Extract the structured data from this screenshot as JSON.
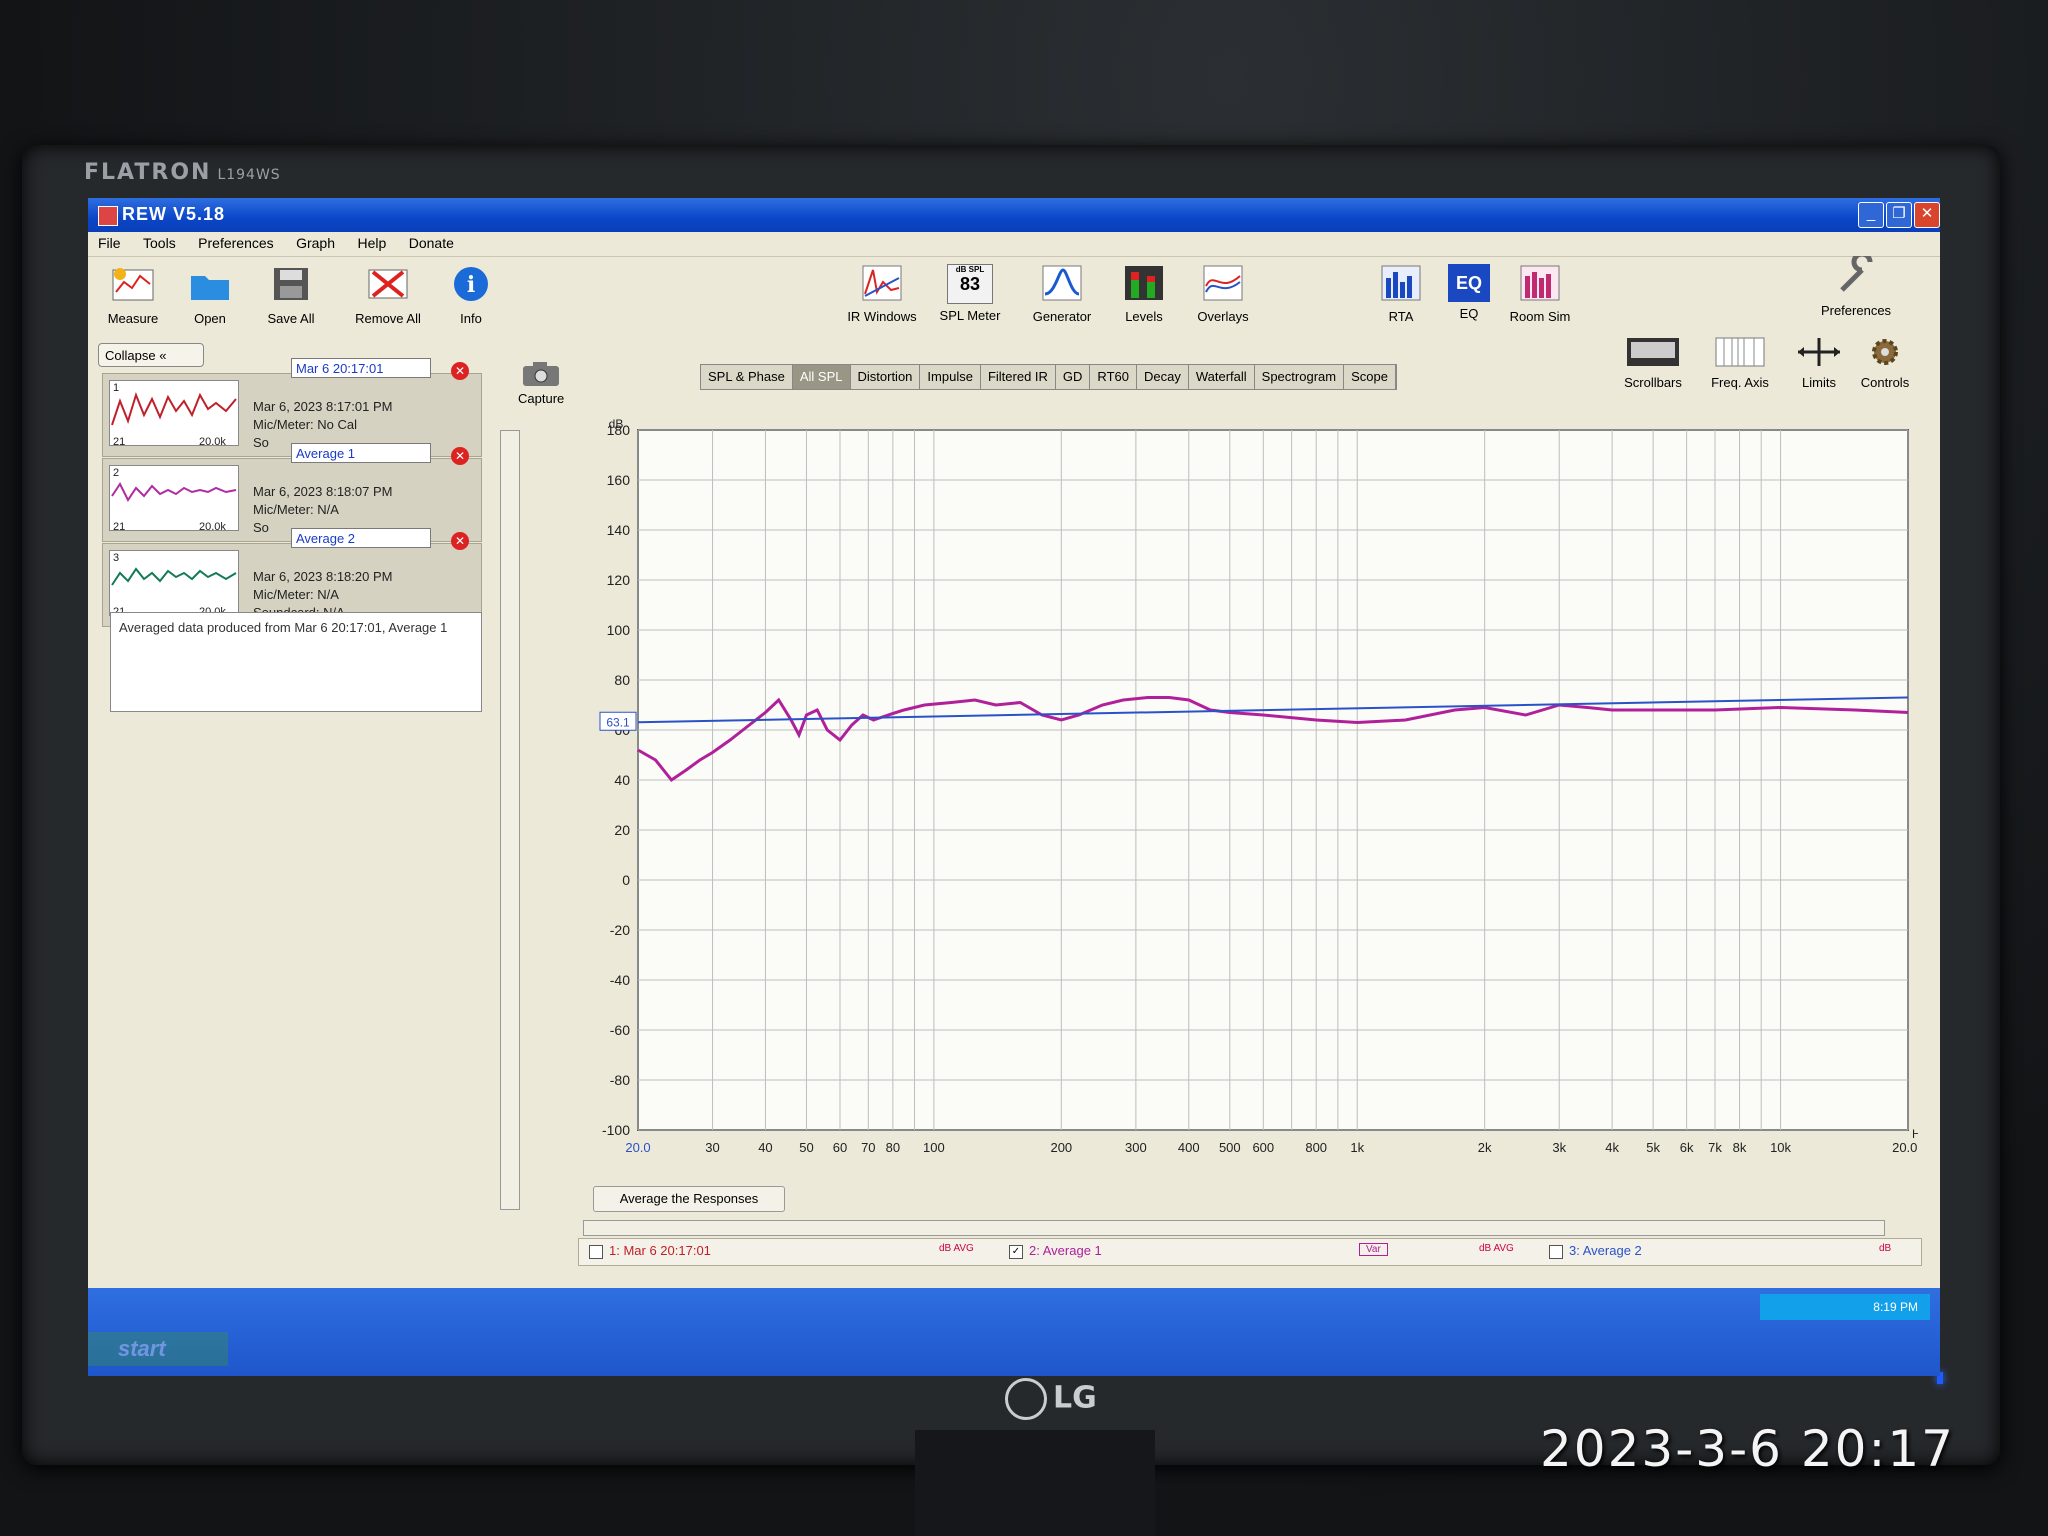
{
  "monitor": {
    "brand": "FLATRON",
    "model": "L194WS",
    "logo": "LG"
  },
  "photo_timestamp": "2023-3-6 20:17",
  "app": {
    "title": "REW V5.18"
  },
  "menu": [
    "File",
    "Tools",
    "Preferences",
    "Graph",
    "Help",
    "Donate"
  ],
  "toolbar_left": [
    {
      "label": "Measure",
      "icon": "measure-icon"
    },
    {
      "label": "Open",
      "icon": "folder-open-icon"
    },
    {
      "label": "Save All",
      "icon": "save-all-icon"
    },
    {
      "label": "Remove All",
      "icon": "remove-all-icon"
    },
    {
      "label": "Info",
      "icon": "info-icon"
    }
  ],
  "toolbar_center": [
    {
      "label": "IR Windows",
      "icon": "ir-windows-icon"
    },
    {
      "label": "SPL Meter",
      "icon": "spl-meter-icon",
      "badge_top": "dB SPL",
      "badge_value": "83"
    },
    {
      "label": "Generator",
      "icon": "generator-icon"
    },
    {
      "label": "Levels",
      "icon": "levels-icon"
    },
    {
      "label": "Overlays",
      "icon": "overlays-icon"
    },
    {
      "label": "RTA",
      "icon": "rta-icon"
    },
    {
      "label": "EQ",
      "icon": "eq-icon"
    },
    {
      "label": "Room Sim",
      "icon": "room-sim-icon"
    }
  ],
  "toolbar_right": {
    "preferences": "Preferences"
  },
  "graph_controls": [
    {
      "label": "Scrollbars",
      "icon": "scrollbars-icon"
    },
    {
      "label": "Freq. Axis",
      "icon": "freq-axis-icon"
    },
    {
      "label": "Limits",
      "icon": "limits-icon"
    },
    {
      "label": "Controls",
      "icon": "controls-gear-icon"
    }
  ],
  "capture_label": "Capture",
  "collapse_label": "Collapse",
  "measurements": [
    {
      "index": "1",
      "name": "Mar 6 20:17:01",
      "date": "Mar 6, 2023 8:17:01 PM",
      "mic": "Mic/Meter: No Cal",
      "extra": "So",
      "range_lo": "21",
      "range_hi": "20.0k",
      "color": "#c0202a"
    },
    {
      "index": "2",
      "name": "Average 1",
      "date": "Mar 6, 2023 8:18:07 PM",
      "mic": "Mic/Meter: N/A",
      "extra": "So",
      "range_lo": "21",
      "range_hi": "20.0k",
      "color": "#b02aa0"
    },
    {
      "index": "3",
      "name": "Average 2",
      "date": "Mar 6, 2023 8:18:20 PM",
      "mic": "Mic/Meter: N/A",
      "extra": "Soundcard: N/A",
      "range_lo": "21",
      "range_hi": "20.0k",
      "color": "#127a5a"
    }
  ],
  "notes": "Averaged data produced from Mar 6 20:17:01, Average 1",
  "tabs": [
    {
      "label": "SPL & Phase",
      "active": false
    },
    {
      "label": "All SPL",
      "active": true
    },
    {
      "label": "Distortion",
      "active": false
    },
    {
      "label": "Impulse",
      "active": false
    },
    {
      "label": "Filtered IR",
      "active": false
    },
    {
      "label": "GD",
      "active": false
    },
    {
      "label": "RT60",
      "active": false
    },
    {
      "label": "Decay",
      "active": false
    },
    {
      "label": "Waterfall",
      "active": false
    },
    {
      "label": "Spectrogram",
      "active": false
    },
    {
      "label": "Scope",
      "active": false
    }
  ],
  "chart_data": {
    "type": "line",
    "ylabel": "dB",
    "xlabel": "Hz",
    "xscale": "log",
    "xlim": [
      20,
      20000
    ],
    "ylim": [
      -100,
      180
    ],
    "yticks": [
      180,
      160,
      140,
      120,
      100,
      80,
      60,
      40,
      20,
      0,
      -20,
      -40,
      -60,
      -80,
      -100
    ],
    "xticks": [
      20,
      30,
      40,
      50,
      60,
      70,
      80,
      100,
      200,
      300,
      400,
      500,
      600,
      800,
      1000,
      2000,
      3000,
      4000,
      5000,
      6000,
      7000,
      8000,
      10000,
      20000
    ],
    "xtick_labels": [
      "20.0",
      "30",
      "40",
      "50",
      "60",
      "70",
      "80",
      "100",
      "200",
      "300",
      "400",
      "500",
      "600",
      "800",
      "1k",
      "2k",
      "3k",
      "4k",
      "5k",
      "6k",
      "7k",
      "8k",
      "10k",
      "20.0k"
    ],
    "y_marker": "63.1",
    "grid": true,
    "series": [
      {
        "name": "2: Average 1",
        "color": "#b0209a",
        "x": [
          20,
          22,
          24,
          26,
          28,
          30,
          33,
          36,
          40,
          43,
          46,
          48,
          50,
          53,
          56,
          60,
          64,
          68,
          72,
          78,
          85,
          95,
          110,
          125,
          140,
          160,
          180,
          200,
          220,
          250,
          280,
          320,
          360,
          400,
          450,
          500,
          600,
          800,
          1000,
          1300,
          1700,
          2000,
          2500,
          3000,
          3500,
          4000,
          5000,
          7000,
          10000,
          15000,
          20000
        ],
        "y": [
          52,
          48,
          40,
          44,
          48,
          51,
          56,
          61,
          67,
          72,
          64,
          58,
          66,
          68,
          60,
          56,
          62,
          66,
          64,
          66,
          68,
          70,
          71,
          72,
          70,
          71,
          66,
          64,
          66,
          70,
          72,
          73,
          73,
          72,
          68,
          67,
          66,
          64,
          63,
          64,
          68,
          69,
          66,
          70,
          69,
          68,
          68,
          68,
          69,
          68,
          67
        ]
      },
      {
        "name": "Average 2",
        "color": "#2a52c8",
        "x": [
          20,
          20000
        ],
        "y": [
          63.1,
          73
        ]
      }
    ]
  },
  "average_button": "Average the Responses",
  "legend": [
    {
      "label": "1: Mar 6 20:17:01",
      "checked": false,
      "tag": "dB AVG"
    },
    {
      "label": "2: Average 1",
      "checked": true,
      "tag": "Var"
    },
    {
      "label": "3: Average 2",
      "checked": false,
      "tag": "dB AVG"
    }
  ],
  "legend_right": "dB",
  "taskbar": {
    "start": "start",
    "clock": "8:19 PM"
  }
}
